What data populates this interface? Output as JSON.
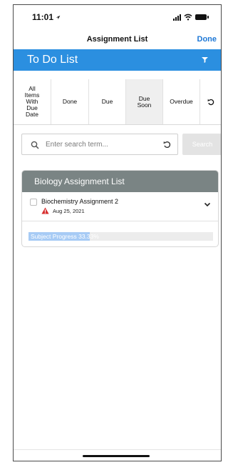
{
  "status_bar": {
    "time": "11:01",
    "location_icon": "location-arrow-icon",
    "icons": [
      "cellular-signal-icon",
      "wifi-icon",
      "battery-icon"
    ]
  },
  "nav": {
    "title": "Assignment List",
    "done_label": "Done"
  },
  "header": {
    "title": "To Do List",
    "filter_icon": "filter-icon",
    "color": "#2b8fe0"
  },
  "filters": [
    {
      "label": "All Items With Due Date"
    },
    {
      "label": "Done"
    },
    {
      "label": "Due"
    },
    {
      "label": "Due Soon",
      "selected": true
    },
    {
      "label": "Overdue"
    }
  ],
  "search": {
    "placeholder": "Enter search term...",
    "button_label": "Search"
  },
  "course": {
    "title": "Biology Assignment List",
    "header_color": "#7a8484",
    "assignments": [
      {
        "name": "Biochemistry Assignment 2",
        "due_date": "Aug 25, 2021",
        "status_icon": "warning-icon",
        "checked": false
      }
    ],
    "progress": {
      "label": "Subject Progress 33.33%",
      "percent": 33.33
    }
  }
}
